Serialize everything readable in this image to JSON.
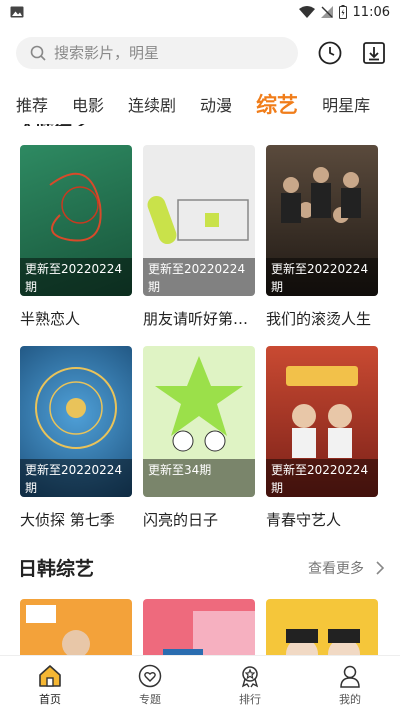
{
  "status_bar": {
    "time": "11:06"
  },
  "search": {
    "placeholder": "搜索影片，明星"
  },
  "tabs": [
    {
      "label": "推荐",
      "active": false
    },
    {
      "label": "电影",
      "active": false
    },
    {
      "label": "连续剧",
      "active": false
    },
    {
      "label": "动漫",
      "active": false
    },
    {
      "label": "综艺",
      "active": true
    },
    {
      "label": "明星库",
      "active": false
    }
  ],
  "section_cut": {
    "title": "大陆综艺"
  },
  "shows": [
    {
      "title": "半熟恋人",
      "badge": "更新至20220224期",
      "color": "#1f6b4d"
    },
    {
      "title": "朋友请听好第…",
      "badge": "更新至20220224期",
      "color": "#e8e8e8"
    },
    {
      "title": "我们的滚烫人生",
      "badge": "更新至20220224期",
      "color": "#3a2e24"
    },
    {
      "title": "大侦探 第七季",
      "badge": "更新至20220224期",
      "color": "#2f78b0"
    },
    {
      "title": "闪亮的日子",
      "badge": "更新至34期",
      "color": "#8fd64a"
    },
    {
      "title": "青春守艺人",
      "badge": "更新至20220224期",
      "color": "#b8402e"
    }
  ],
  "section_jk": {
    "title": "日韩综艺",
    "more": "查看更多"
  },
  "jk_shows": [
    {
      "color": "#f3a23a"
    },
    {
      "color": "#ee6a7d"
    },
    {
      "color": "#f5c63a"
    }
  ],
  "bottom_nav": [
    {
      "label": "首页",
      "active": true
    },
    {
      "label": "专题",
      "active": false
    },
    {
      "label": "排行",
      "active": false
    },
    {
      "label": "我的",
      "active": false
    }
  ],
  "colors": {
    "accent": "#f07d1a"
  }
}
